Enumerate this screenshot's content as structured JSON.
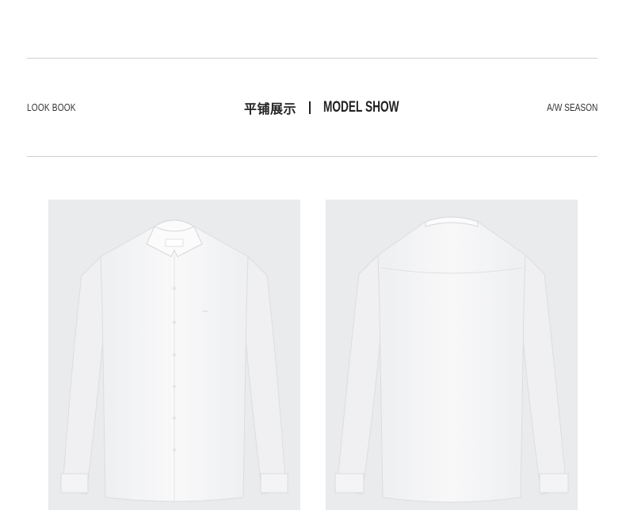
{
  "header": {
    "left_label": "LOOK BOOK",
    "center_cn": "平铺展示",
    "center_en": "MODEL SHOW",
    "right_label": "A/W SEASON"
  },
  "photos": [
    {
      "name": "shirt-front",
      "kind": "front"
    },
    {
      "name": "shirt-back",
      "kind": "back"
    }
  ],
  "colors": {
    "background": "#ffffff",
    "rule": "#cfcfcf",
    "photo_bg": "#eaebed",
    "shirt": "#f6f6f7"
  }
}
